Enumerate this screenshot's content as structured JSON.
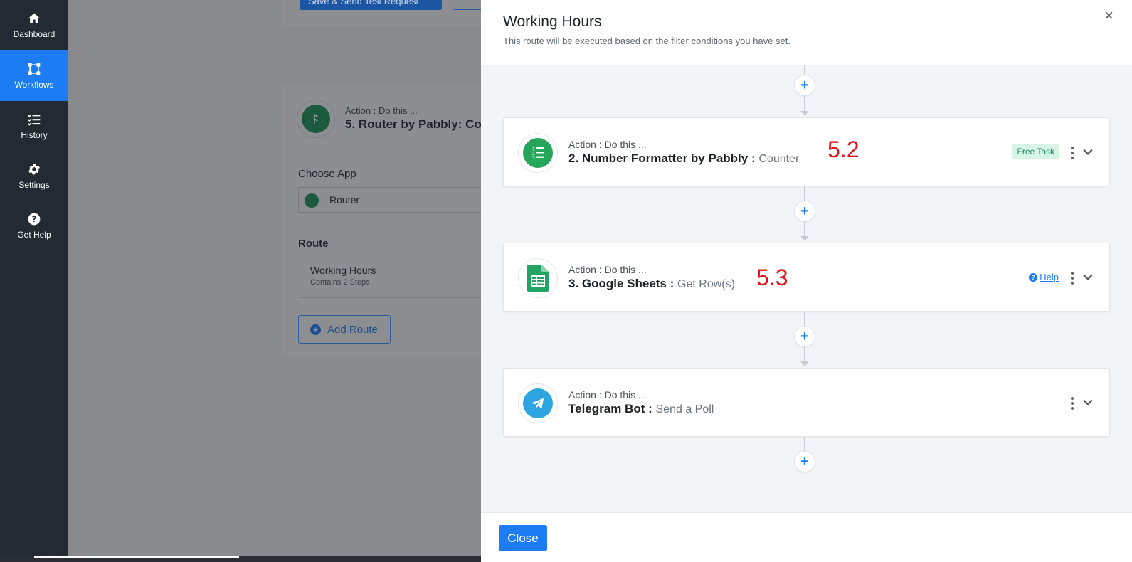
{
  "sidebar": {
    "items": [
      {
        "label": "Dashboard",
        "icon": "home-icon"
      },
      {
        "label": "Workflows",
        "icon": "workflow-icon",
        "active": true
      },
      {
        "label": "History",
        "icon": "history-list-icon"
      },
      {
        "label": "Settings",
        "icon": "gear-icon"
      },
      {
        "label": "Get Help",
        "icon": "question-icon"
      }
    ]
  },
  "background": {
    "save_button": "Save & Send Test Request",
    "card": {
      "action_label": "Action : Do this ...",
      "title": "5. Router by Pabbly: Co",
      "choose_app_label": "Choose App",
      "selected_app": "Router",
      "route_heading": "Route",
      "route_name": "Working Hours",
      "route_steps": "Contains 2 Steps",
      "add_route_label": "Add Route"
    }
  },
  "panel": {
    "title": "Working Hours",
    "subtitle": "This route will be executed based on the filter conditions you have set.",
    "close_x": "×",
    "steps": [
      {
        "action_label": "Action : Do this ...",
        "app_name": "2. Number Formatter by Pabbly :",
        "event": "Counter",
        "annotation": "5.2",
        "badge": "Free Task",
        "icon": "number-formatter-icon",
        "color": "#26a65b"
      },
      {
        "action_label": "Action : Do this ...",
        "app_name": "3. Google Sheets :",
        "event": "Get Row(s)",
        "annotation": "5.3",
        "help_label": "Help",
        "icon": "google-sheets-icon",
        "color": "#21a464"
      },
      {
        "action_label": "Action : Do this ...",
        "app_name": "Telegram Bot :",
        "event": "Send a Poll",
        "icon": "telegram-icon",
        "color": "#2ca5e0"
      }
    ],
    "footer": {
      "close_label": "Close"
    }
  },
  "colors": {
    "accent": "#1c7cf4",
    "sidebar_bg": "#232a33",
    "annotation": "#e0141a"
  }
}
